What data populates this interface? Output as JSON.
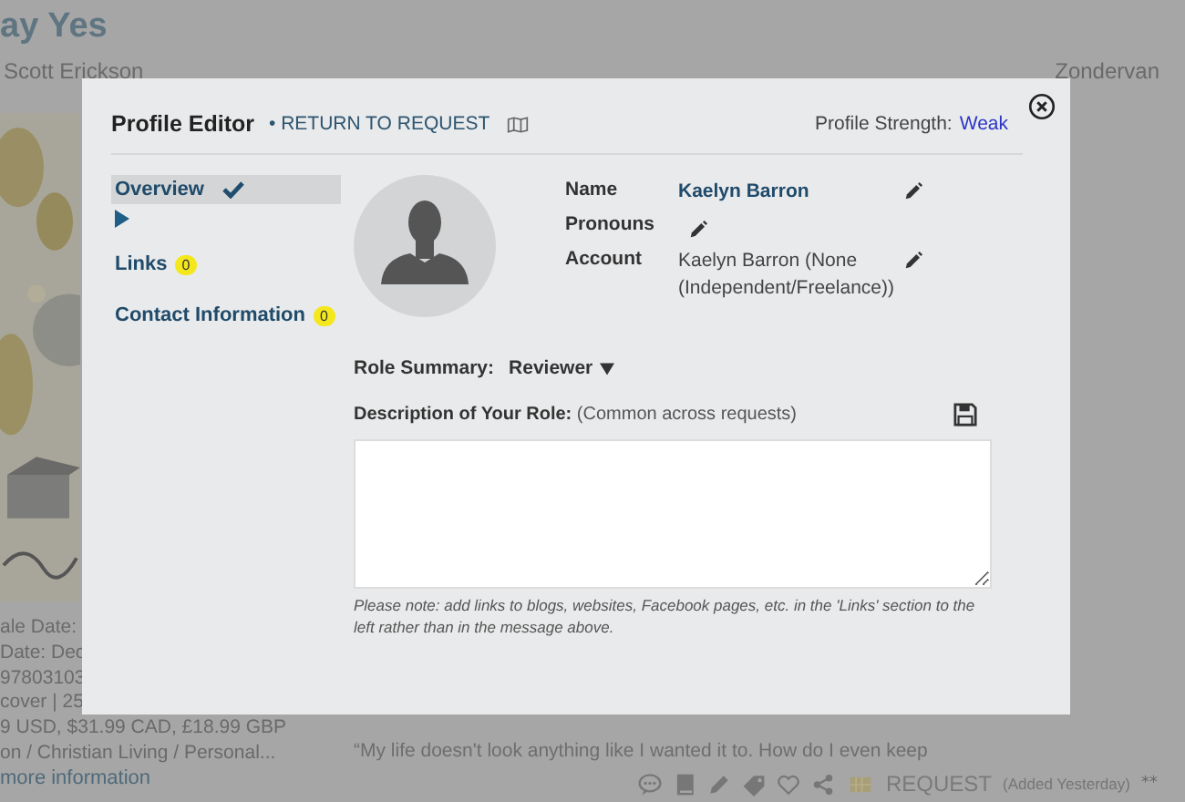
{
  "background_page": {
    "title": "ay Yes",
    "author": "Scott Erickson",
    "publisher": "Zondervan",
    "details": [
      "ale Date:",
      "Date: Dec",
      "97803103",
      "cover | 25",
      "9 USD, $31.99 CAD, £18.99 GBP",
      "on / Christian Living / Personal..."
    ],
    "more_link": "more information",
    "quote": "“My life doesn't look anything like I wanted it to. How do I even keep",
    "actions": {
      "request_label": "REQUEST",
      "added": "(Added Yesterday)",
      "more": "**"
    }
  },
  "modal": {
    "title": "Profile Editor",
    "return_link": "• RETURN TO REQUEST",
    "strength_label": "Profile Strength:",
    "strength_value": "Weak",
    "nav": [
      {
        "label": "Overview",
        "selected": true,
        "checked": true
      },
      {
        "label": "Links",
        "selected": false,
        "checked": false,
        "badge": "0"
      },
      {
        "label": "Contact Information",
        "selected": false,
        "checked": false,
        "badge": "0"
      }
    ],
    "fields": [
      {
        "label": "Name",
        "kind": "link",
        "value": "Kaelyn Barron"
      },
      {
        "label": "Pronouns",
        "kind": "empty"
      },
      {
        "label": "Account",
        "kind": "text",
        "value": "Kaelyn Barron (None (Independent/Freelance))"
      }
    ],
    "role": {
      "label": "Role Summary:",
      "value": "Reviewer"
    },
    "description": {
      "label": "**Description of Your Role:** (Common across requests)",
      "note": "Please note: add links to blogs, websites, Facebook pages, etc. in the 'Links' section to the left rather than in the message above."
    }
  }
}
